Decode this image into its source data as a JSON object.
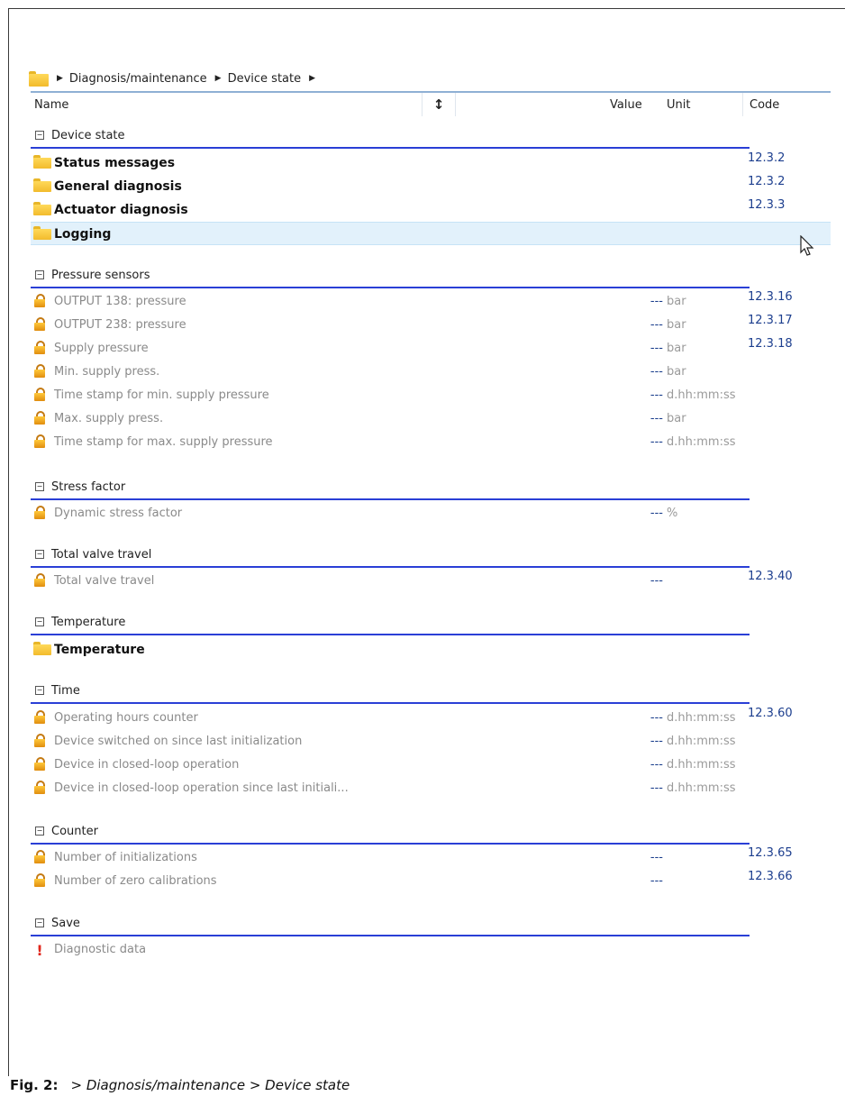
{
  "breadcrumb": {
    "icon": "folder-icon",
    "items": [
      "Diagnosis/maintenance",
      "Device state"
    ]
  },
  "header": {
    "name": "Name",
    "value": "Value",
    "unit": "Unit",
    "code": "Code",
    "sort_icon": "sort-arrows-icon"
  },
  "groups": {
    "device_state": "Device state",
    "pressure_sensors": "Pressure sensors",
    "stress_factor": "Stress factor",
    "total_valve_travel": "Total valve travel",
    "temperature": "Temperature",
    "time": "Time",
    "counter": "Counter",
    "save": "Save"
  },
  "device_state_rows": [
    {
      "name": "Status messages",
      "code": "12.3.2"
    },
    {
      "name": "General diagnosis",
      "code": "12.3.2"
    },
    {
      "name": "Actuator diagnosis",
      "code": "12.3.3"
    },
    {
      "name": "Logging",
      "code": ""
    }
  ],
  "pressure_rows": [
    {
      "name": "OUTPUT 138: pressure",
      "value": "---",
      "unit": "bar",
      "code": "12.3.16"
    },
    {
      "name": "OUTPUT 238: pressure",
      "value": "---",
      "unit": "bar",
      "code": "12.3.17"
    },
    {
      "name": "Supply pressure",
      "value": "---",
      "unit": "bar",
      "code": "12.3.18"
    },
    {
      "name": "Min. supply press.",
      "value": "---",
      "unit": "bar",
      "code": ""
    },
    {
      "name": "Time stamp for min. supply pressure",
      "value": "---",
      "unit": "d.hh:mm:ss",
      "code": ""
    },
    {
      "name": "Max. supply press.",
      "value": "---",
      "unit": "bar",
      "code": ""
    },
    {
      "name": "Time stamp for max. supply pressure",
      "value": "---",
      "unit": "d.hh:mm:ss",
      "code": ""
    }
  ],
  "stress_rows": [
    {
      "name": "Dynamic stress factor",
      "value": "---",
      "unit": "%",
      "code": ""
    }
  ],
  "travel_rows": [
    {
      "name": "Total valve travel",
      "value": "---",
      "unit": "",
      "code": "12.3.40"
    }
  ],
  "temperature_rows": [
    {
      "name": "Temperature"
    }
  ],
  "time_rows": [
    {
      "name": "Operating hours counter",
      "value": "---",
      "unit": "d.hh:mm:ss",
      "code": "12.3.60"
    },
    {
      "name": "Device switched on since last initialization",
      "value": "---",
      "unit": "d.hh:mm:ss",
      "code": ""
    },
    {
      "name": "Device in closed-loop operation",
      "value": "---",
      "unit": "d.hh:mm:ss",
      "code": ""
    },
    {
      "name": "Device in closed-loop operation since last initiali...",
      "value": "---",
      "unit": "d.hh:mm:ss",
      "code": ""
    }
  ],
  "counter_rows": [
    {
      "name": "Number of initializations",
      "value": "---",
      "unit": "",
      "code": "12.3.65"
    },
    {
      "name": "Number of zero calibrations",
      "value": "---",
      "unit": "",
      "code": "12.3.66"
    }
  ],
  "save_rows": [
    {
      "name": "Diagnostic data"
    }
  ],
  "caption": {
    "label": "Fig. 2:",
    "text": "> Diagnosis/maintenance > Device state"
  },
  "colors": {
    "group_line": "#2a3fd6",
    "highlight": "#e2f1fb",
    "code_text": "#1c3e8e"
  }
}
